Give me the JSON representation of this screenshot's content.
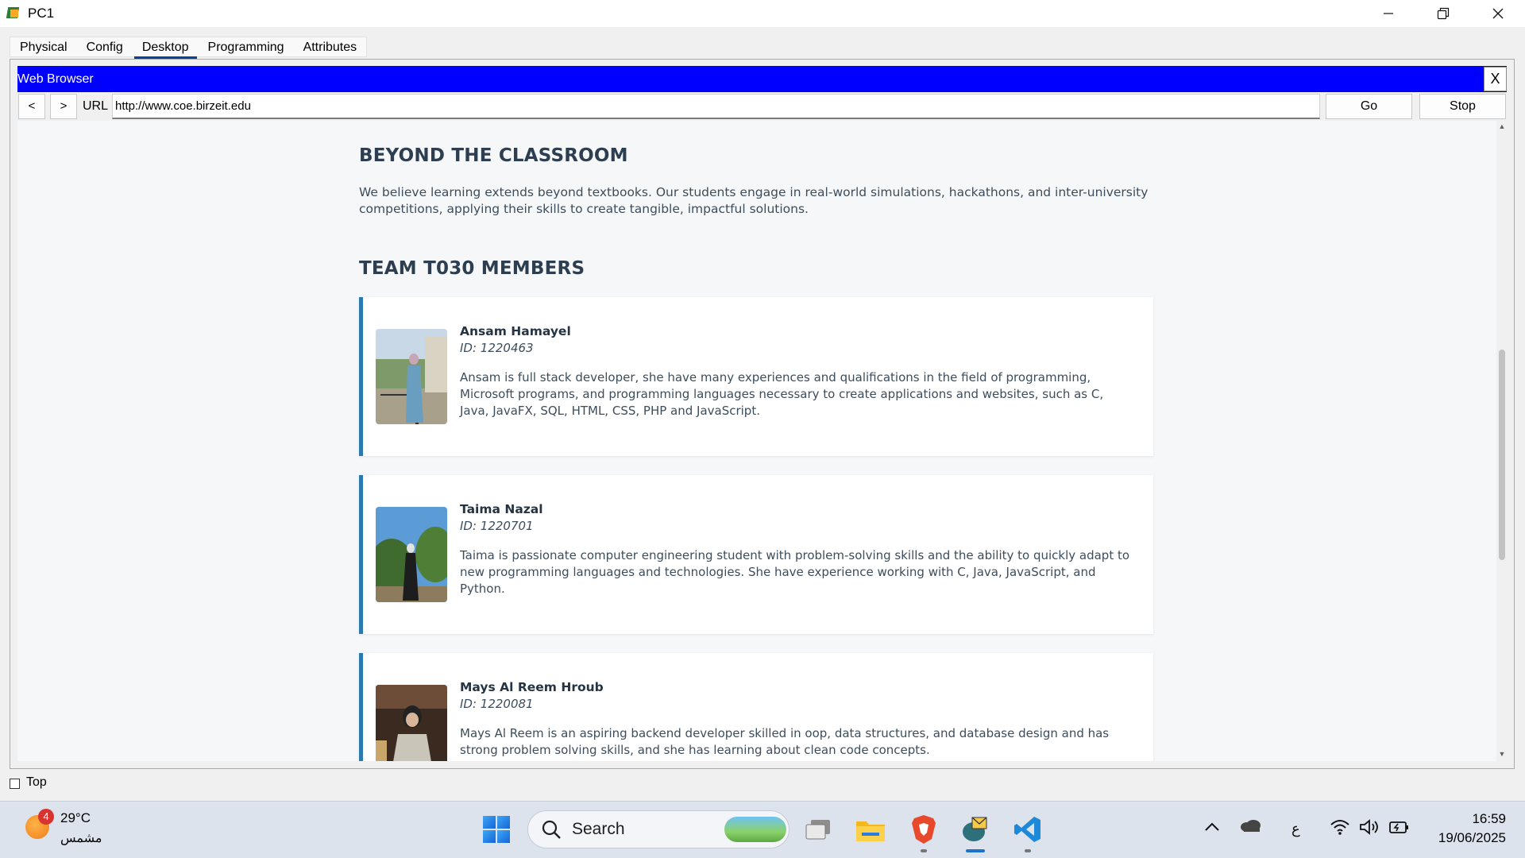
{
  "window": {
    "title": "PC1"
  },
  "tabs": [
    {
      "label": "Physical"
    },
    {
      "label": "Config"
    },
    {
      "label": "Desktop"
    },
    {
      "label": "Programming"
    },
    {
      "label": "Attributes"
    }
  ],
  "browser": {
    "title": "Web Browser",
    "close_label": "X",
    "back_label": "<",
    "forward_label": ">",
    "url_label": "URL",
    "url_value": "http://www.coe.birzeit.edu",
    "go_label": "Go",
    "stop_label": "Stop"
  },
  "page": {
    "beyond_title": "BEYOND THE CLASSROOM",
    "beyond_text": "We believe learning extends beyond textbooks. Our students engage in real-world simulations, hackathons, and inter-university competitions, applying their skills to create tangible, impactful solutions.",
    "team_title": "TEAM T030 MEMBERS",
    "members": [
      {
        "name": "Ansam Hamayel",
        "id": "ID: 1220463",
        "desc": "Ansam is full stack developer, she have many experiences and qualifications in the field of programming, Microsoft programs, and programming languages necessary to create applications and websites, such as C, Java, JavaFX, SQL, HTML, CSS, PHP and JavaScript."
      },
      {
        "name": "Taima Nazal",
        "id": "ID: 1220701",
        "desc": "Taima is passionate computer engineering student with problem-solving skills and the ability to quickly adapt to new programming languages and technologies. She have experience working with C, Java, JavaScript, and Python."
      },
      {
        "name": "Mays Al Reem Hroub",
        "id": "ID: 1220081",
        "desc": "Mays Al Reem is an aspiring backend developer skilled in oop, data structures, and database design and has strong problem solving skills, and she has learning about clean code concepts."
      }
    ]
  },
  "footer": {
    "top_label": "Top"
  },
  "taskbar": {
    "weather_badge": "4",
    "temperature": "29°C",
    "weather_desc": "مشمس",
    "search_label": "Search",
    "lang_indicator": "ع",
    "time": "16:59",
    "date": "19/06/2025"
  },
  "colors": {
    "browser_header": "#0000ff",
    "card_accent": "#2a7ab0",
    "tab_underline": "#0a3f9a"
  }
}
